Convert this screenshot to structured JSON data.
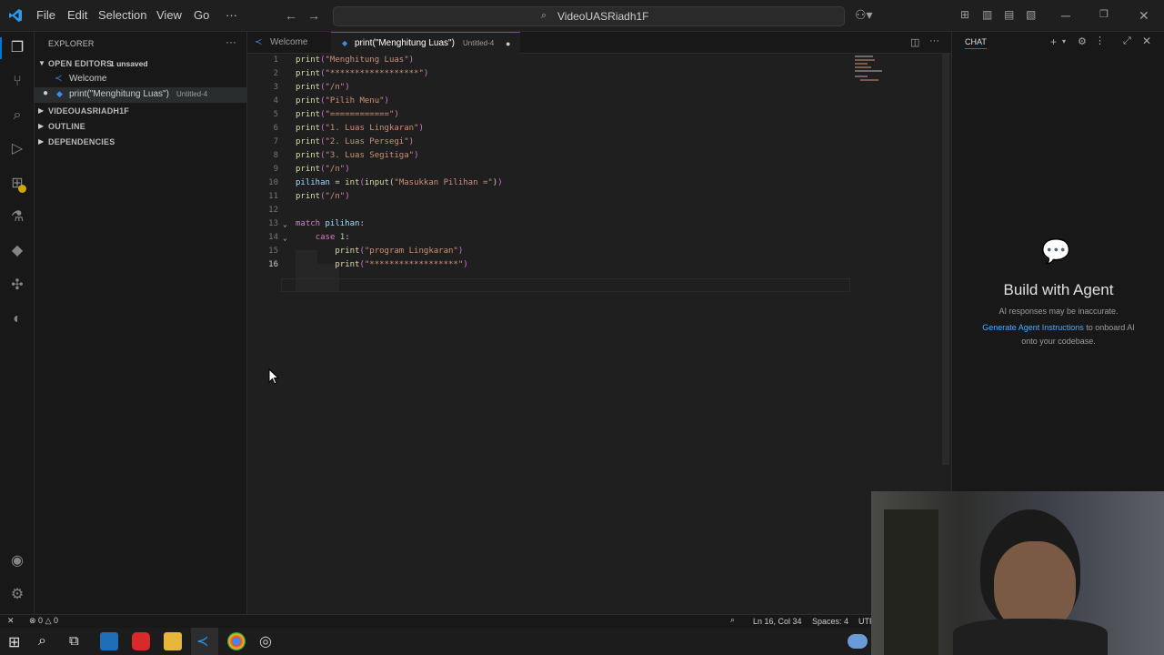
{
  "menu": [
    "File",
    "Edit",
    "Selection",
    "View",
    "Go",
    "···"
  ],
  "search": {
    "label": "VideoUASRiadh1F"
  },
  "sidebar": {
    "title": "EXPLORER",
    "open_editors": "OPEN EDITORS",
    "unsaved_badge": "1 unsaved",
    "open_files": [
      {
        "name": "Welcome",
        "detail": ""
      },
      {
        "name": "print(\"Menghitung Luas\")",
        "detail": "Untitled-4"
      }
    ],
    "sections": [
      "VIDEOUASRIADH1F",
      "OUTLINE",
      "DEPENDENCIES"
    ]
  },
  "tabs": [
    {
      "label": "Welcome",
      "detail": ""
    },
    {
      "label": "print(\"Menghitung Luas\")",
      "detail": "Untitled-4"
    }
  ],
  "code_lines": [
    {
      "n": "1",
      "t": "print(\"Menghitung Luas\")"
    },
    {
      "n": "2",
      "t": "print(\"******************\")"
    },
    {
      "n": "3",
      "t": "print(\"/n\")"
    },
    {
      "n": "4",
      "t": "print(\"Pilih Menu\")"
    },
    {
      "n": "5",
      "t": "print(\"============\")"
    },
    {
      "n": "6",
      "t": "print(\"1. Luas Lingkaran\")"
    },
    {
      "n": "7",
      "t": "print(\"2. Luas Persegi\")"
    },
    {
      "n": "8",
      "t": "print(\"3. Luas Segitiga\")"
    },
    {
      "n": "9",
      "t": "print(\"/n\")"
    },
    {
      "n": "10",
      "t": "pilihan = int(input(\"Masukkan Pilihan =\"))"
    },
    {
      "n": "11",
      "t": "print(\"/n\")"
    },
    {
      "n": "12",
      "t": ""
    },
    {
      "n": "13",
      "t": "match pilihan:"
    },
    {
      "n": "14",
      "t": "    case 1:"
    },
    {
      "n": "15",
      "t": "        print(\"program Lingkaran\")"
    },
    {
      "n": "16",
      "t": "        print(\"******************\")"
    }
  ],
  "chat": {
    "header": "CHAT",
    "title": "Build with Agent",
    "disclaimer": "AI responses may be inaccurate.",
    "link": "Generate Agent Instructions",
    "link_suffix": " to onboard AI",
    "link_suffix2": "onto your codebase."
  },
  "status": {
    "errors": "0",
    "warnings": "0",
    "position": "Ln 16, Col 34",
    "spaces": "Spaces: 4",
    "encoding": "UTF"
  },
  "colors": {
    "accent": "#0078d4",
    "link": "#4daafc",
    "warning_badge": "#cca700"
  }
}
